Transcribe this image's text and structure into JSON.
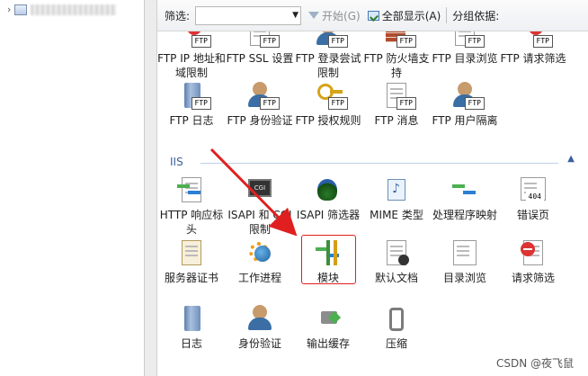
{
  "filter_bar": {
    "filter_label": "筛选:",
    "filter_value": "",
    "start_button": "开始(G)",
    "show_all_button": "全部显示(A)",
    "group_by_label": "分组依据:"
  },
  "ftp_row1": [
    {
      "label": "FTP IP 地址和域限制",
      "icon": "ftp-ip-restrictions-icon",
      "badge": "FTP"
    },
    {
      "label": "FTP SSL 设置",
      "icon": "ftp-ssl-icon",
      "badge": "FTP"
    },
    {
      "label": "FTP 登录尝试限制",
      "icon": "ftp-logon-attempt-icon",
      "badge": "FTP"
    },
    {
      "label": "FTP 防火墙支持",
      "icon": "ftp-firewall-icon",
      "badge": "FTP"
    },
    {
      "label": "FTP 目录浏览",
      "icon": "ftp-directory-browsing-icon",
      "badge": "FTP"
    },
    {
      "label": "FTP 请求筛选",
      "icon": "ftp-request-filtering-icon",
      "badge": "FTP"
    }
  ],
  "ftp_row2": [
    {
      "label": "FTP 日志",
      "icon": "ftp-logging-icon",
      "badge": "FTP"
    },
    {
      "label": "FTP 身份验证",
      "icon": "ftp-authentication-icon",
      "badge": "FTP"
    },
    {
      "label": "FTP 授权规则",
      "icon": "ftp-authorization-icon",
      "badge": "FTP"
    },
    {
      "label": "FTP 消息",
      "icon": "ftp-messages-icon",
      "badge": "FTP"
    },
    {
      "label": "FTP 用户隔离",
      "icon": "ftp-user-isolation-icon",
      "badge": "FTP"
    }
  ],
  "iis_section": {
    "title": "IIS"
  },
  "iis_row1": [
    {
      "label": "HTTP 响应标头",
      "icon": "http-response-headers-icon"
    },
    {
      "label": "ISAPI 和 CGI 限制",
      "icon": "isapi-cgi-restrictions-icon"
    },
    {
      "label": "ISAPI 筛选器",
      "icon": "isapi-filters-icon"
    },
    {
      "label": "MIME 类型",
      "icon": "mime-types-icon"
    },
    {
      "label": "处理程序映射",
      "icon": "handler-mappings-icon"
    },
    {
      "label": "错误页",
      "icon": "error-pages-icon",
      "badge": "404"
    }
  ],
  "iis_row2": [
    {
      "label": "服务器证书",
      "icon": "server-certificates-icon"
    },
    {
      "label": "工作进程",
      "icon": "worker-processes-icon"
    },
    {
      "label": "模块",
      "icon": "modules-icon"
    },
    {
      "label": "默认文档",
      "icon": "default-document-icon"
    },
    {
      "label": "目录浏览",
      "icon": "directory-browsing-icon"
    },
    {
      "label": "请求筛选",
      "icon": "request-filtering-icon"
    }
  ],
  "iis_row3": [
    {
      "label": "日志",
      "icon": "logging-icon"
    },
    {
      "label": "身份验证",
      "icon": "authentication-icon"
    },
    {
      "label": "输出缓存",
      "icon": "output-caching-icon"
    },
    {
      "label": "压缩",
      "icon": "compression-icon"
    }
  ],
  "watermark": "CSDN @夜飞鼠",
  "colors": {
    "annotation": "#e02020",
    "link_blue": "#3a5fa0"
  }
}
